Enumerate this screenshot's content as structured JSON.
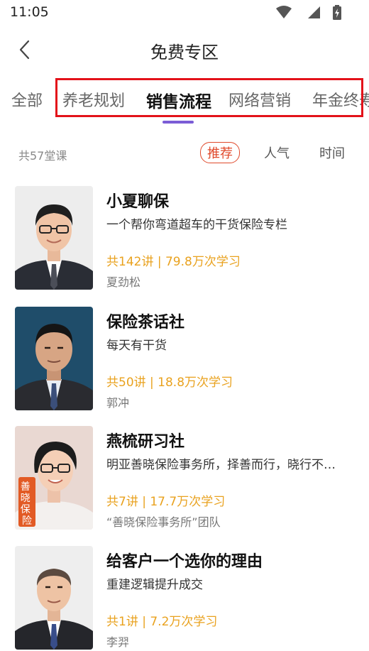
{
  "status": {
    "time": "11:05"
  },
  "header": {
    "title": "免费专区"
  },
  "tabs": [
    {
      "label": "全部"
    },
    {
      "label": "养老规划"
    },
    {
      "label": "销售流程"
    },
    {
      "label": "网络营销"
    },
    {
      "label": "年金终寿"
    }
  ],
  "filter": {
    "count_text": "共57堂课",
    "sort_options": [
      {
        "label": "推荐"
      },
      {
        "label": "人气"
      },
      {
        "label": "时间"
      }
    ]
  },
  "courses": [
    {
      "title": "小夏聊保",
      "subtitle": "一个帮你弯道超车的干货保险专栏",
      "stats": "共142讲 | 79.8万次学习",
      "author": "夏劲松"
    },
    {
      "title": "保险茶话社",
      "subtitle": "每天有干货",
      "stats": "共50讲 | 18.8万次学习",
      "author": "郭冲"
    },
    {
      "title": "燕梳研习社",
      "subtitle": "明亚善晓保险事务所，择善而行，晓行不…",
      "stats": "共7讲 | 17.7万次学习",
      "author": "“善晓保险事务所”团队",
      "thumb_badge": "善晓保险"
    },
    {
      "title": "给客户一个选你的理由",
      "subtitle": "重建逻辑提升成交",
      "stats": "共1讲 | 7.2万次学习",
      "author": "李羿"
    }
  ],
  "colors": {
    "accent": "#7b5cd6",
    "highlight": "#e3121a",
    "stats": "#e9a21f",
    "sort_active": "#e0492b"
  }
}
